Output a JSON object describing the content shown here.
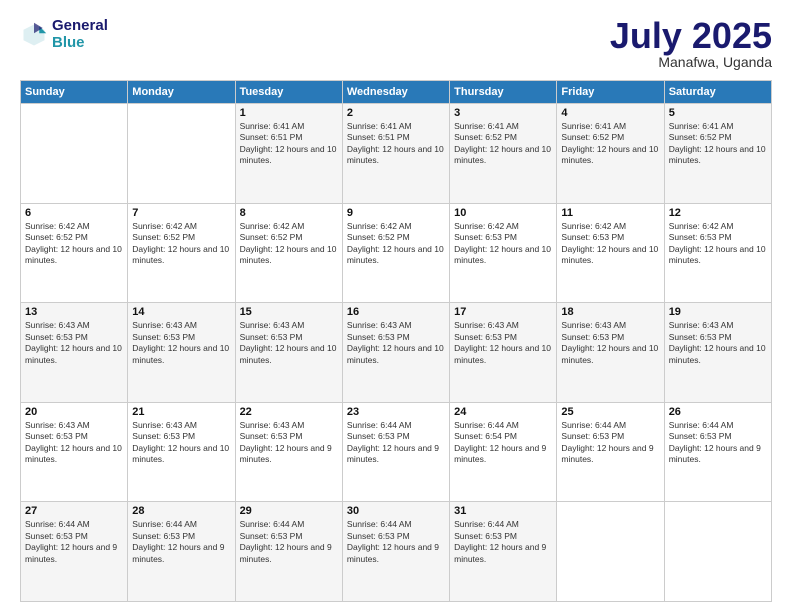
{
  "logo": {
    "line1": "General",
    "line2": "Blue"
  },
  "title": "July 2025",
  "subtitle": "Manafwa, Uganda",
  "headers": [
    "Sunday",
    "Monday",
    "Tuesday",
    "Wednesday",
    "Thursday",
    "Friday",
    "Saturday"
  ],
  "weeks": [
    [
      {
        "day": "",
        "sunrise": "",
        "sunset": "",
        "daylight": ""
      },
      {
        "day": "",
        "sunrise": "",
        "sunset": "",
        "daylight": ""
      },
      {
        "day": "1",
        "sunrise": "Sunrise: 6:41 AM",
        "sunset": "Sunset: 6:51 PM",
        "daylight": "Daylight: 12 hours and 10 minutes."
      },
      {
        "day": "2",
        "sunrise": "Sunrise: 6:41 AM",
        "sunset": "Sunset: 6:51 PM",
        "daylight": "Daylight: 12 hours and 10 minutes."
      },
      {
        "day": "3",
        "sunrise": "Sunrise: 6:41 AM",
        "sunset": "Sunset: 6:52 PM",
        "daylight": "Daylight: 12 hours and 10 minutes."
      },
      {
        "day": "4",
        "sunrise": "Sunrise: 6:41 AM",
        "sunset": "Sunset: 6:52 PM",
        "daylight": "Daylight: 12 hours and 10 minutes."
      },
      {
        "day": "5",
        "sunrise": "Sunrise: 6:41 AM",
        "sunset": "Sunset: 6:52 PM",
        "daylight": "Daylight: 12 hours and 10 minutes."
      }
    ],
    [
      {
        "day": "6",
        "sunrise": "Sunrise: 6:42 AM",
        "sunset": "Sunset: 6:52 PM",
        "daylight": "Daylight: 12 hours and 10 minutes."
      },
      {
        "day": "7",
        "sunrise": "Sunrise: 6:42 AM",
        "sunset": "Sunset: 6:52 PM",
        "daylight": "Daylight: 12 hours and 10 minutes."
      },
      {
        "day": "8",
        "sunrise": "Sunrise: 6:42 AM",
        "sunset": "Sunset: 6:52 PM",
        "daylight": "Daylight: 12 hours and 10 minutes."
      },
      {
        "day": "9",
        "sunrise": "Sunrise: 6:42 AM",
        "sunset": "Sunset: 6:52 PM",
        "daylight": "Daylight: 12 hours and 10 minutes."
      },
      {
        "day": "10",
        "sunrise": "Sunrise: 6:42 AM",
        "sunset": "Sunset: 6:53 PM",
        "daylight": "Daylight: 12 hours and 10 minutes."
      },
      {
        "day": "11",
        "sunrise": "Sunrise: 6:42 AM",
        "sunset": "Sunset: 6:53 PM",
        "daylight": "Daylight: 12 hours and 10 minutes."
      },
      {
        "day": "12",
        "sunrise": "Sunrise: 6:42 AM",
        "sunset": "Sunset: 6:53 PM",
        "daylight": "Daylight: 12 hours and 10 minutes."
      }
    ],
    [
      {
        "day": "13",
        "sunrise": "Sunrise: 6:43 AM",
        "sunset": "Sunset: 6:53 PM",
        "daylight": "Daylight: 12 hours and 10 minutes."
      },
      {
        "day": "14",
        "sunrise": "Sunrise: 6:43 AM",
        "sunset": "Sunset: 6:53 PM",
        "daylight": "Daylight: 12 hours and 10 minutes."
      },
      {
        "day": "15",
        "sunrise": "Sunrise: 6:43 AM",
        "sunset": "Sunset: 6:53 PM",
        "daylight": "Daylight: 12 hours and 10 minutes."
      },
      {
        "day": "16",
        "sunrise": "Sunrise: 6:43 AM",
        "sunset": "Sunset: 6:53 PM",
        "daylight": "Daylight: 12 hours and 10 minutes."
      },
      {
        "day": "17",
        "sunrise": "Sunrise: 6:43 AM",
        "sunset": "Sunset: 6:53 PM",
        "daylight": "Daylight: 12 hours and 10 minutes."
      },
      {
        "day": "18",
        "sunrise": "Sunrise: 6:43 AM",
        "sunset": "Sunset: 6:53 PM",
        "daylight": "Daylight: 12 hours and 10 minutes."
      },
      {
        "day": "19",
        "sunrise": "Sunrise: 6:43 AM",
        "sunset": "Sunset: 6:53 PM",
        "daylight": "Daylight: 12 hours and 10 minutes."
      }
    ],
    [
      {
        "day": "20",
        "sunrise": "Sunrise: 6:43 AM",
        "sunset": "Sunset: 6:53 PM",
        "daylight": "Daylight: 12 hours and 10 minutes."
      },
      {
        "day": "21",
        "sunrise": "Sunrise: 6:43 AM",
        "sunset": "Sunset: 6:53 PM",
        "daylight": "Daylight: 12 hours and 10 minutes."
      },
      {
        "day": "22",
        "sunrise": "Sunrise: 6:43 AM",
        "sunset": "Sunset: 6:53 PM",
        "daylight": "Daylight: 12 hours and 9 minutes."
      },
      {
        "day": "23",
        "sunrise": "Sunrise: 6:44 AM",
        "sunset": "Sunset: 6:53 PM",
        "daylight": "Daylight: 12 hours and 9 minutes."
      },
      {
        "day": "24",
        "sunrise": "Sunrise: 6:44 AM",
        "sunset": "Sunset: 6:54 PM",
        "daylight": "Daylight: 12 hours and 9 minutes."
      },
      {
        "day": "25",
        "sunrise": "Sunrise: 6:44 AM",
        "sunset": "Sunset: 6:53 PM",
        "daylight": "Daylight: 12 hours and 9 minutes."
      },
      {
        "day": "26",
        "sunrise": "Sunrise: 6:44 AM",
        "sunset": "Sunset: 6:53 PM",
        "daylight": "Daylight: 12 hours and 9 minutes."
      }
    ],
    [
      {
        "day": "27",
        "sunrise": "Sunrise: 6:44 AM",
        "sunset": "Sunset: 6:53 PM",
        "daylight": "Daylight: 12 hours and 9 minutes."
      },
      {
        "day": "28",
        "sunrise": "Sunrise: 6:44 AM",
        "sunset": "Sunset: 6:53 PM",
        "daylight": "Daylight: 12 hours and 9 minutes."
      },
      {
        "day": "29",
        "sunrise": "Sunrise: 6:44 AM",
        "sunset": "Sunset: 6:53 PM",
        "daylight": "Daylight: 12 hours and 9 minutes."
      },
      {
        "day": "30",
        "sunrise": "Sunrise: 6:44 AM",
        "sunset": "Sunset: 6:53 PM",
        "daylight": "Daylight: 12 hours and 9 minutes."
      },
      {
        "day": "31",
        "sunrise": "Sunrise: 6:44 AM",
        "sunset": "Sunset: 6:53 PM",
        "daylight": "Daylight: 12 hours and 9 minutes."
      },
      {
        "day": "",
        "sunrise": "",
        "sunset": "",
        "daylight": ""
      },
      {
        "day": "",
        "sunrise": "",
        "sunset": "",
        "daylight": ""
      }
    ]
  ]
}
